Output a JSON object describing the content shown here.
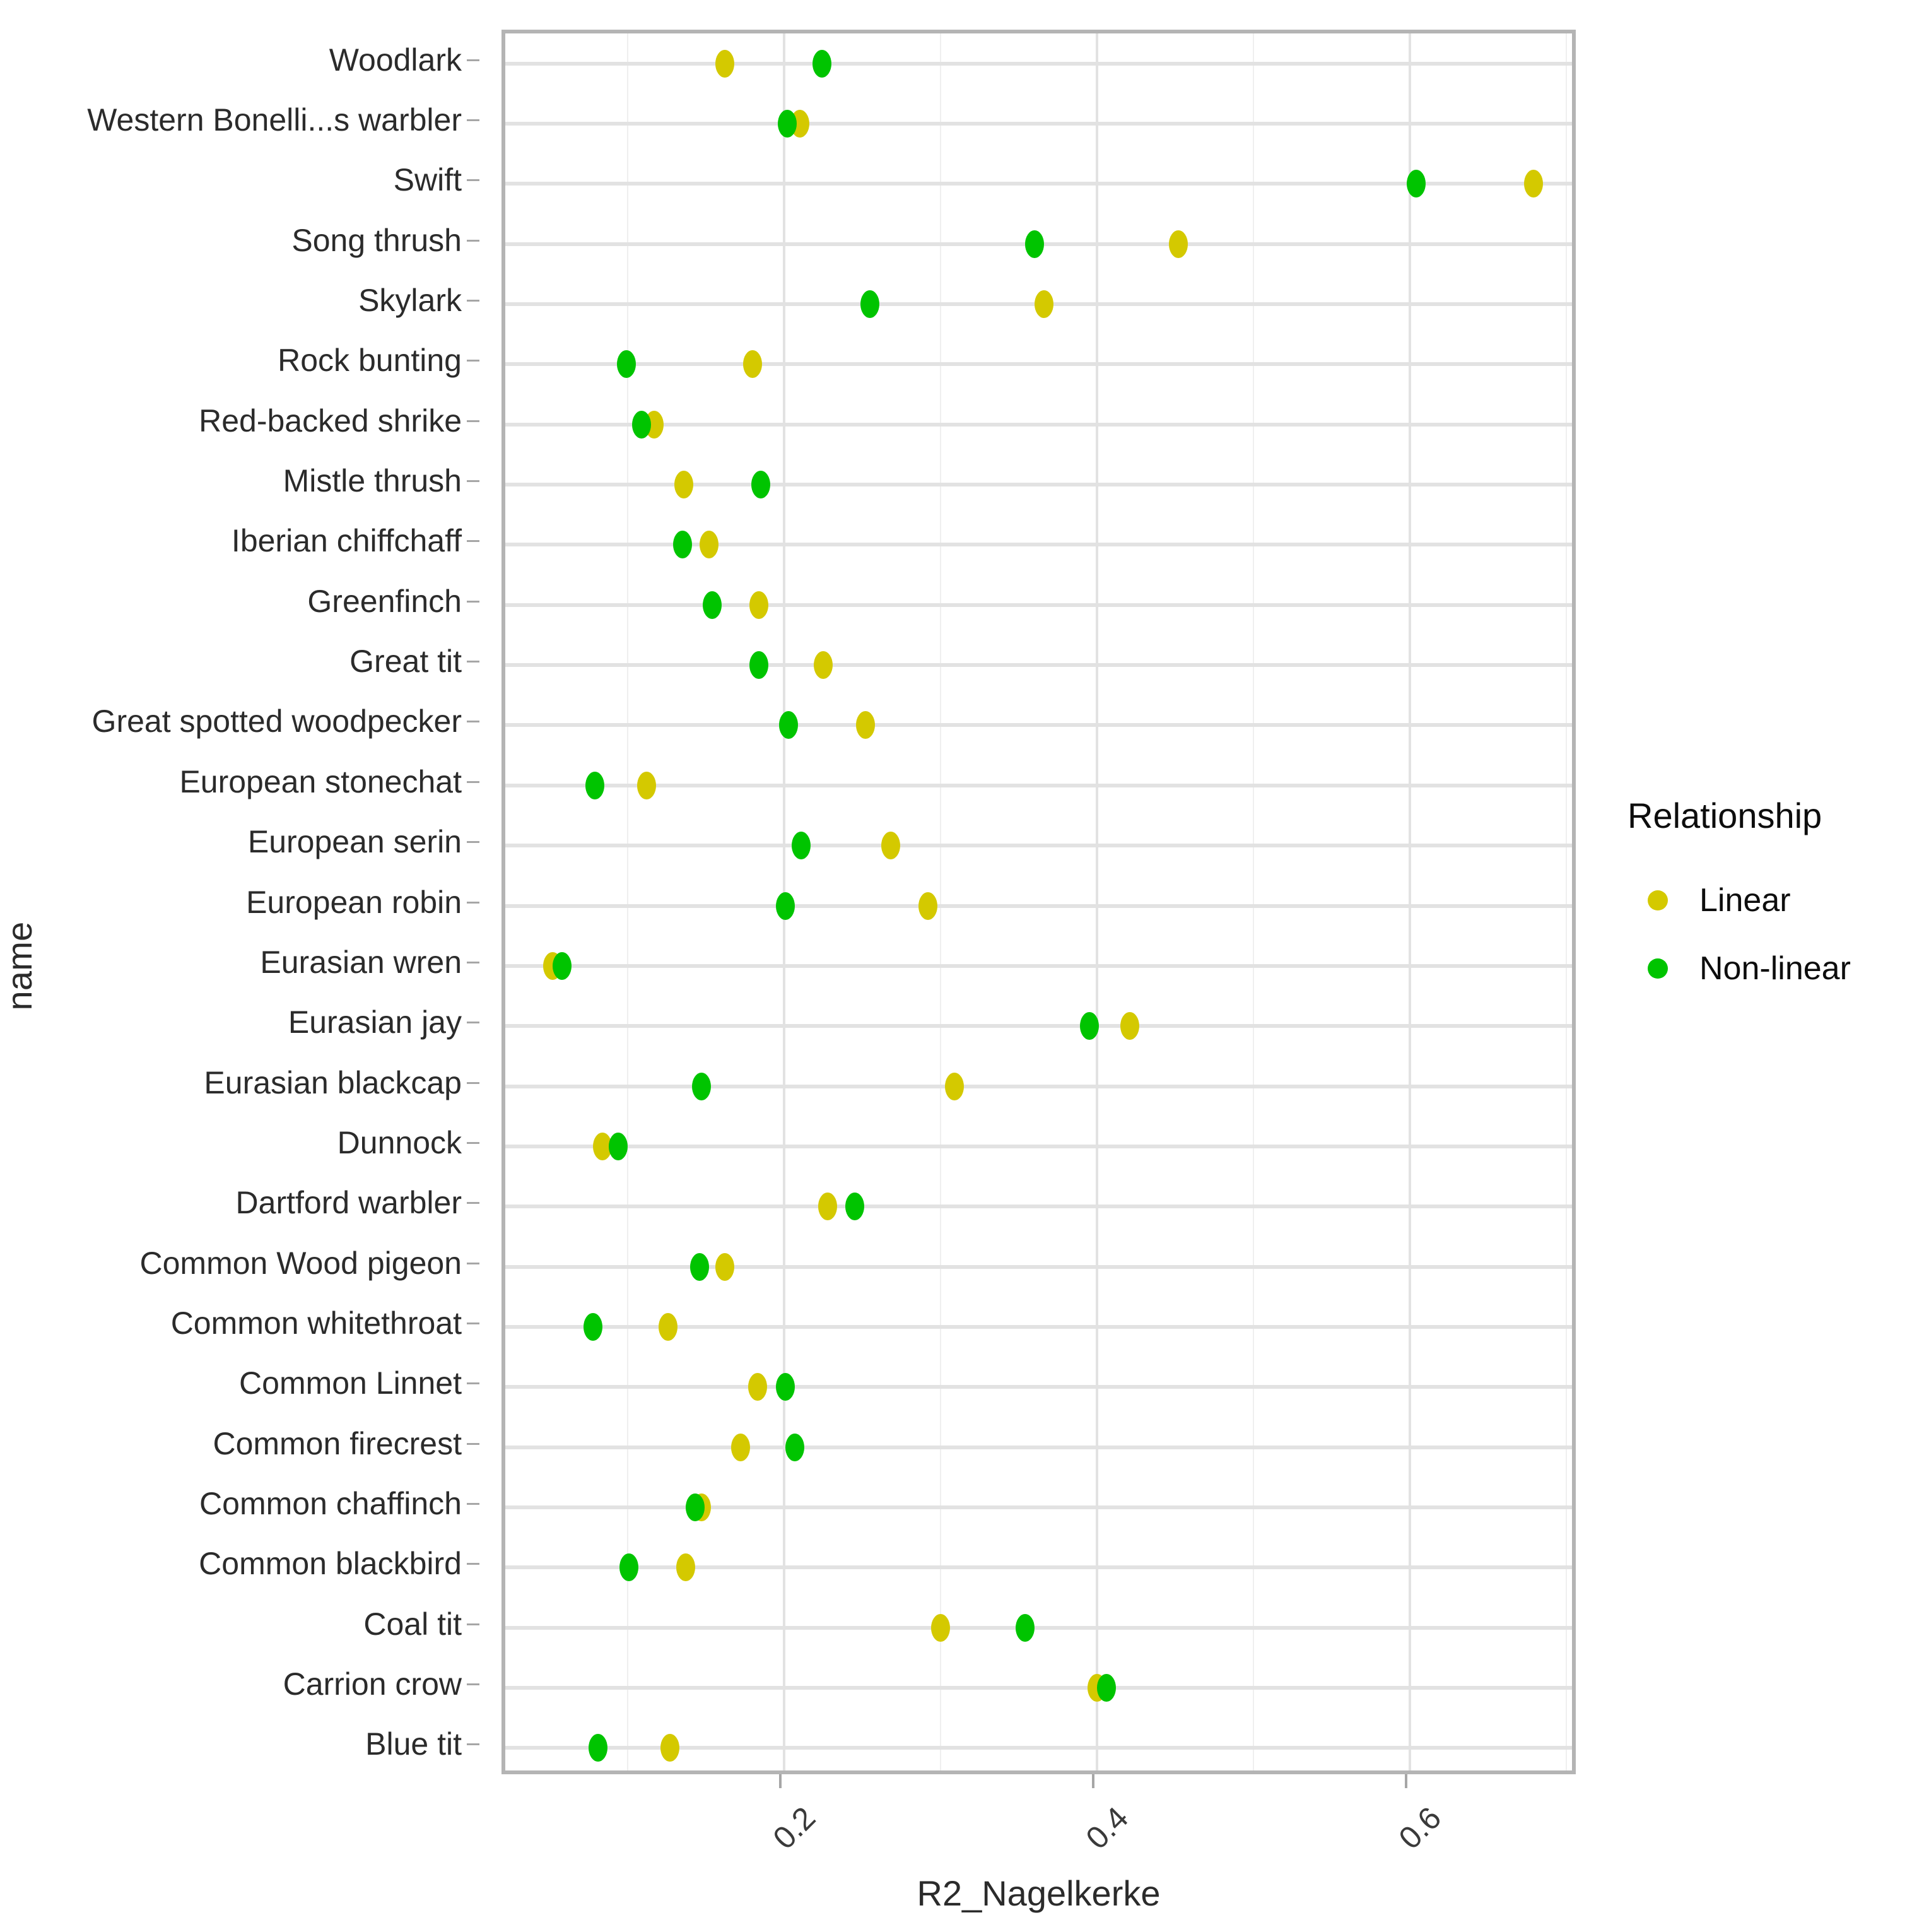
{
  "axes": {
    "y_title": "name",
    "x_title": "R2_Nagelkerke",
    "x_ticks": [
      "0.2",
      "0.4",
      "0.6"
    ]
  },
  "legend": {
    "title": "Relationship",
    "items": [
      {
        "label": "Linear",
        "color": "#d4c900"
      },
      {
        "label": "Non-linear",
        "color": "#00c400"
      }
    ]
  },
  "chart_data": {
    "type": "scatter",
    "title": "",
    "xlabel": "R2_Nagelkerke",
    "ylabel": "name",
    "xlim": [
      0.022,
      0.709
    ],
    "xticks": [
      0.2,
      0.4,
      0.6
    ],
    "grid": true,
    "legend_position": "right",
    "legend_title": "Relationship",
    "categories": [
      "Woodlark",
      "Western Bonelli...s warbler",
      "Swift",
      "Song thrush",
      "Skylark",
      "Rock bunting",
      "Red-backed shrike",
      "Mistle thrush",
      "Iberian chiffchaff",
      "Greenfinch",
      "Great tit",
      "Great spotted woodpecker",
      "European stonechat",
      "European serin",
      "European robin",
      "Eurasian wren",
      "Eurasian jay",
      "Eurasian blackcap",
      "Dunnock",
      "Dartford warbler",
      "Common Wood pigeon",
      "Common whitethroat",
      "Common Linnet",
      "Common firecrest",
      "Common chaffinch",
      "Common blackbird",
      "Coal tit",
      "Carrion crow",
      "Blue tit"
    ],
    "series": [
      {
        "name": "Linear",
        "color": "#d4c900",
        "values": [
          0.162,
          0.21,
          0.679,
          0.452,
          0.366,
          0.18,
          0.117,
          0.136,
          0.152,
          0.184,
          0.225,
          0.252,
          0.112,
          0.268,
          0.292,
          0.052,
          0.421,
          0.309,
          0.084,
          0.228,
          0.162,
          0.126,
          0.183,
          0.172,
          0.147,
          0.137,
          0.3,
          0.4,
          0.127
        ]
      },
      {
        "name": "Non-linear",
        "color": "#00c400",
        "values": [
          0.224,
          0.202,
          0.604,
          0.36,
          0.255,
          0.099,
          0.109,
          0.185,
          0.135,
          0.154,
          0.184,
          0.203,
          0.079,
          0.211,
          0.201,
          0.058,
          0.395,
          0.147,
          0.094,
          0.245,
          0.146,
          0.078,
          0.201,
          0.207,
          0.143,
          0.101,
          0.354,
          0.406,
          0.081
        ]
      }
    ]
  }
}
